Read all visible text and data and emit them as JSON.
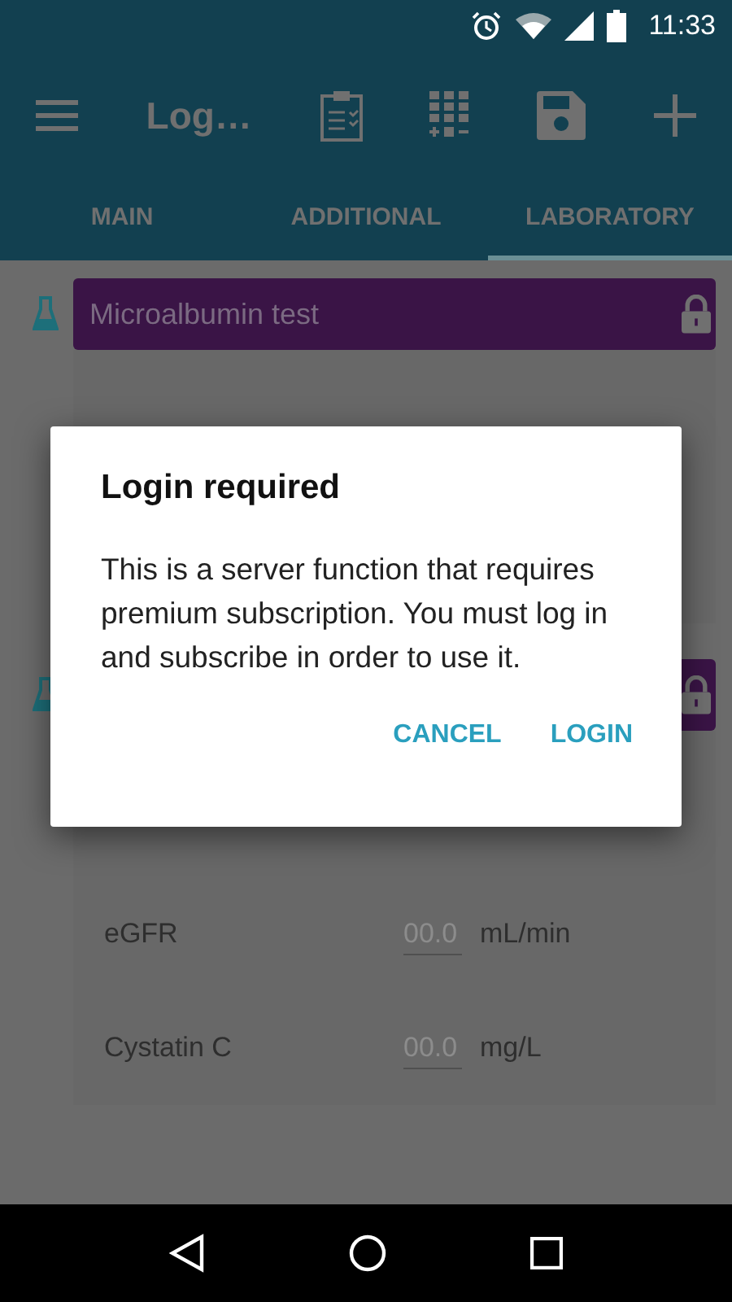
{
  "status_bar": {
    "time": "11:33"
  },
  "app_bar": {
    "title": "Log…"
  },
  "tabs": [
    {
      "label": "MAIN",
      "selected": false
    },
    {
      "label": "ADDITIONAL",
      "selected": false
    },
    {
      "label": "LABORATORY",
      "selected": true
    }
  ],
  "sections": [
    {
      "title": "Microalbumin test",
      "locked": true
    },
    {
      "locked": true,
      "rows": [
        {
          "label": "eGFR",
          "placeholder": "00.0",
          "unit": "mL/min"
        },
        {
          "label": "Cystatin C",
          "placeholder": "00.0",
          "unit": "mg/L"
        }
      ]
    }
  ],
  "dialog": {
    "title": "Login required",
    "message": "This is a server function that requires premium subscription. You must log in and subscribe in order to use it.",
    "buttons": [
      "CANCEL",
      "LOGIN"
    ]
  }
}
